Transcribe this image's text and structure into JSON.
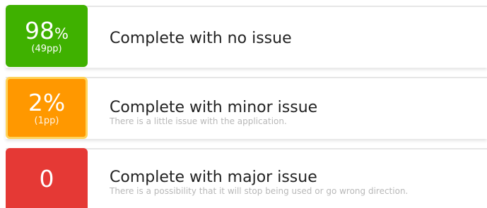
{
  "items": [
    {
      "badge_value": "98",
      "badge_suffix": "%",
      "badge_sub": "(49pp)",
      "title": "Complete with no issue",
      "description": "",
      "color": "#3fb100"
    },
    {
      "badge_value": "2",
      "badge_suffix": "%",
      "badge_sub": "(1pp)",
      "title": "Complete with minor issue",
      "description": "There is a little issue with the application.",
      "color": "#ff9800"
    },
    {
      "badge_value": "0",
      "badge_suffix": "",
      "badge_sub": "",
      "title": "Complete with major issue",
      "description": "There is a possibility that it will stop being used or go wrong direction.",
      "color": "#e53935"
    }
  ]
}
